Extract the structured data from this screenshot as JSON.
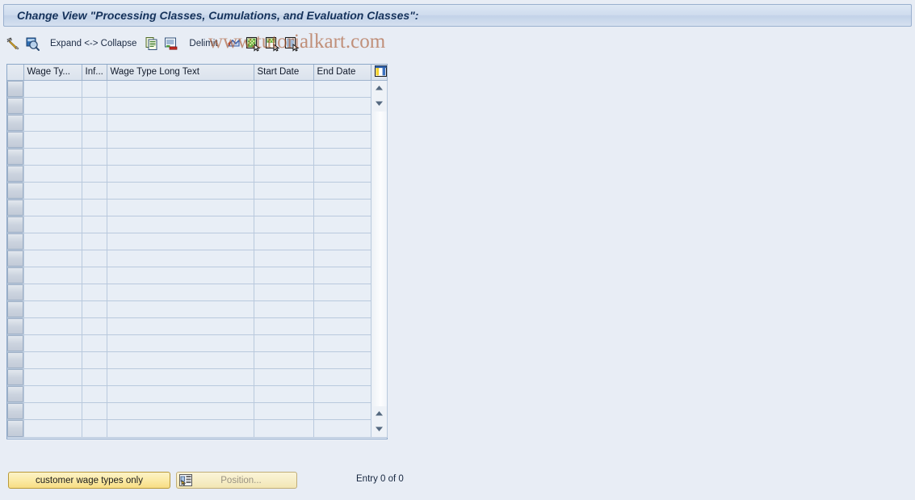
{
  "window": {
    "title": "Change View \"Processing Classes, Cumulations, and Evaluation Classes\":"
  },
  "watermark": {
    "text": "www.tutorialkart.com",
    "color": "#a8562d"
  },
  "toolbar": {
    "items": [
      {
        "name": "display-change-icon",
        "type": "icon",
        "label": ""
      },
      {
        "name": "details-magnifier-icon",
        "type": "icon",
        "label": ""
      },
      {
        "name": "expand-collapse-button",
        "type": "label",
        "label": "Expand <-> Collapse"
      },
      {
        "name": "copy-as-icon",
        "type": "icon",
        "label": ""
      },
      {
        "name": "delete-row-icon",
        "type": "icon",
        "label": ""
      },
      {
        "name": "delimit-button",
        "type": "label",
        "label": "Delimit"
      },
      {
        "name": "undo-arrow-icon",
        "type": "icon",
        "label": ""
      },
      {
        "name": "select-all-icon",
        "type": "icon",
        "label": ""
      },
      {
        "name": "deselect-all-icon",
        "type": "icon",
        "label": ""
      },
      {
        "name": "select-block-icon",
        "type": "icon",
        "label": ""
      }
    ]
  },
  "grid": {
    "columns": [
      {
        "key": "select",
        "label": ""
      },
      {
        "key": "wage_type",
        "label": "Wage Ty..."
      },
      {
        "key": "info",
        "label": "Inf..."
      },
      {
        "key": "long_text",
        "label": "Wage Type Long Text"
      },
      {
        "key": "start_date",
        "label": "Start Date"
      },
      {
        "key": "end_date",
        "label": "End Date"
      },
      {
        "key": "config",
        "label": ""
      }
    ],
    "rows": [],
    "empty_row_count": 21
  },
  "footer": {
    "customer_wage_types_label": "customer wage types only",
    "position_label": "Position...",
    "entry_count_label": "Entry 0 of 0"
  },
  "colors": {
    "page_background": "#e8edf5",
    "title_text": "#15325b",
    "grid_border": "#8ba7c8",
    "accent_yellow": "#fbe9a2"
  }
}
